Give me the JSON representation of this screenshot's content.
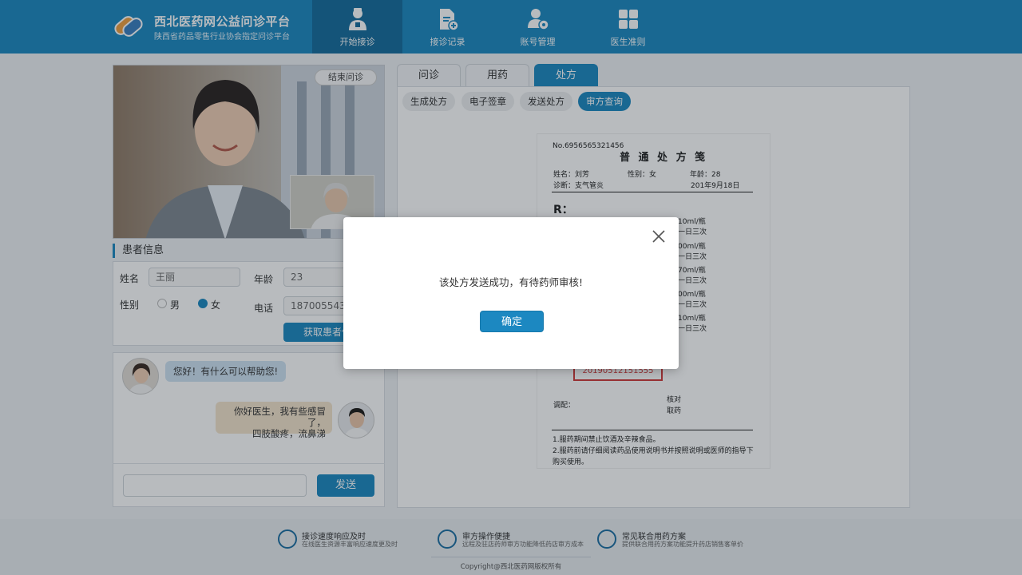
{
  "brand": {
    "title": "西北医药网公益问诊平台",
    "subtitle": "陕西省药品零售行业协会指定问诊平台"
  },
  "nav": [
    {
      "label": "开始接诊",
      "icon": "doctor-icon",
      "active": true
    },
    {
      "label": "接诊记录",
      "icon": "record-add-icon",
      "active": false
    },
    {
      "label": "账号管理",
      "icon": "user-gear-icon",
      "active": false
    },
    {
      "label": "医生准则",
      "icon": "grid-icon",
      "active": false
    }
  ],
  "video": {
    "end_button": "结束问诊"
  },
  "patient_info": {
    "title": "患者信息",
    "name_label": "姓名",
    "name_value": "王丽",
    "age_label": "年龄",
    "age_value": "23",
    "gender_label": "性别",
    "gender_male": "男",
    "gender_female": "女",
    "gender_selected": "女",
    "phone_label": "电话",
    "phone_value": "18700554356",
    "fetch_button": "获取患者信息"
  },
  "chat": {
    "doctor_message": "您好！有什么可以帮助您!",
    "patient_message_line1": "你好医生，我有些感冒了，",
    "patient_message_line2": "四肢酸疼，流鼻涕",
    "send_button": "发送"
  },
  "tabs": [
    {
      "label": "问诊",
      "active": false
    },
    {
      "label": "用药",
      "active": false
    },
    {
      "label": "处方",
      "active": true
    }
  ],
  "subtabs": [
    {
      "label": "生成处方",
      "active": false
    },
    {
      "label": "电子签章",
      "active": false
    },
    {
      "label": "发送处方",
      "active": false
    },
    {
      "label": "审方查询",
      "active": true
    }
  ],
  "prescription": {
    "no": "No.6956565321456",
    "title": "普 通 处 方 笺",
    "name_label": "姓名：",
    "name": "刘芳",
    "gender_label": "性别：",
    "gender": "女",
    "age_label": "年龄：",
    "age": "28",
    "diagnosis_label": "诊断：",
    "diagnosis": "支气管炎",
    "date": "201年9月18日",
    "rx_mark": "R：",
    "items": [
      {
        "spec": "10ml/瓶",
        "freq": "一日三次"
      },
      {
        "spec": "00ml/瓶",
        "freq": "一日三次"
      },
      {
        "spec": "70ml/瓶",
        "freq": "一日三次"
      },
      {
        "spec": "00ml/瓶",
        "freq": "一日三次"
      },
      {
        "spec": "10ml/瓶",
        "freq": "一日三次"
      }
    ],
    "stamp_code": "20190512151555",
    "dispense_label": "调配：",
    "check_label": "核对",
    "pickup_label": "取药",
    "note1": "1.服药期间禁止饮酒及辛辣食品。",
    "note2": "2.服药前请仔细阅读药品使用说明书并按照说明或医师的指导下",
    "note3": "购买使用。"
  },
  "footer": {
    "features": [
      {
        "title": "接诊速度响应及时",
        "sub": "在线医生资源丰富响应速度更及时",
        "icon": "speed-icon"
      },
      {
        "title": "审方操作便捷",
        "sub": "远程及驻店药师审方功能降低药店审方成本",
        "icon": "document-edit-icon"
      },
      {
        "title": "常见联合用药方案",
        "sub": "提供联合用药方案功能提升药店销售客单价",
        "icon": "medicine-icon"
      }
    ],
    "copyright": "Copyright@西北医药网版权所有"
  },
  "modal": {
    "message": "该处方发送成功，有待药师审核!",
    "ok_button": "确定"
  },
  "colors": {
    "primary": "#1c88c1",
    "nav_active": "#156c9c",
    "stamp_red": "#d13a3a"
  }
}
